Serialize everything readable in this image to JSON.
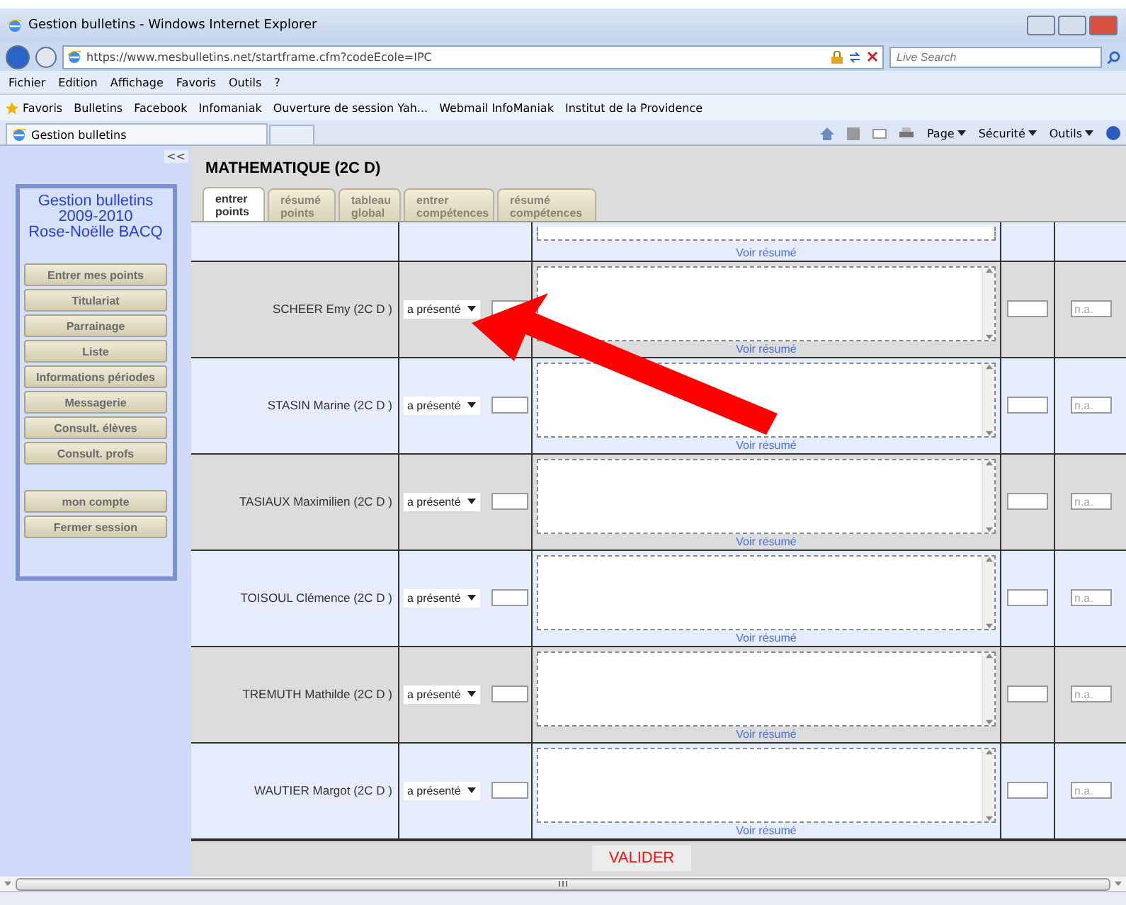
{
  "browser": {
    "title": "Gestion bulletins - Windows Internet Explorer",
    "address": "https://www.mesbulletins.net/startframe.cfm?codeEcole=IPC",
    "search": {
      "placeholder": "Live Search"
    },
    "menu": [
      "Fichier",
      "Edition",
      "Affichage",
      "Favoris",
      "Outils",
      "?"
    ],
    "favorites_label": "Favoris",
    "favorites": [
      "Bulletins",
      "Facebook",
      "Infomaniak",
      "Ouverture de session Yah...",
      "Webmail InfoManiak",
      "Institut de la Providence"
    ],
    "tab": "Gestion bulletins",
    "commands": [
      "Page",
      "Sécurité",
      "Outils"
    ]
  },
  "sidebar": {
    "collapse": "<<",
    "title": [
      "Gestion bulletins",
      "2009-2010",
      "Rose-Noëlle BACQ"
    ],
    "nav": [
      "Entrer mes points",
      "Titulariat",
      "Parrainage",
      "Liste",
      "Informations périodes",
      "Messagerie",
      "Consult. élèves",
      "Consult. profs"
    ],
    "account": [
      "mon compte",
      "Fermer session"
    ]
  },
  "main": {
    "heading": "MATHEMATIQUE (2C D)",
    "tabs": [
      {
        "label": "entrer points",
        "selected": true
      },
      {
        "label": "résumé points",
        "selected": false
      },
      {
        "label": "tableau global",
        "selected": false
      },
      {
        "label": "entrer compétences",
        "selected": false
      },
      {
        "label": "résumé compétences",
        "selected": false
      }
    ],
    "partial_row": {
      "link": "Voir résumé"
    },
    "rows": [
      {
        "name": "SCHEER Emy (2C D )",
        "status": "a présenté",
        "link": "Voir résumé",
        "na_placeholder": "n.a."
      },
      {
        "name": "STASIN Marine (2C D )",
        "status": "a présenté",
        "link": "Voir résumé",
        "na_placeholder": "n.a."
      },
      {
        "name": "TASIAUX Maximilien (2C D )",
        "status": "a présenté",
        "link": "Voir résumé",
        "na_placeholder": "n.a."
      },
      {
        "name": "TOISOUL Clémence (2C D )",
        "status": "a présenté",
        "link": "Voir résumé",
        "na_placeholder": "n.a."
      },
      {
        "name": "TREMUTH Mathilde (2C D )",
        "status": "a présenté",
        "link": "Voir résumé",
        "na_placeholder": "n.a."
      },
      {
        "name": "WAUTIER Margot (2C D )",
        "status": "a présenté",
        "link": "Voir résumé",
        "na_placeholder": "n.a."
      }
    ],
    "submit": "VALIDER"
  }
}
